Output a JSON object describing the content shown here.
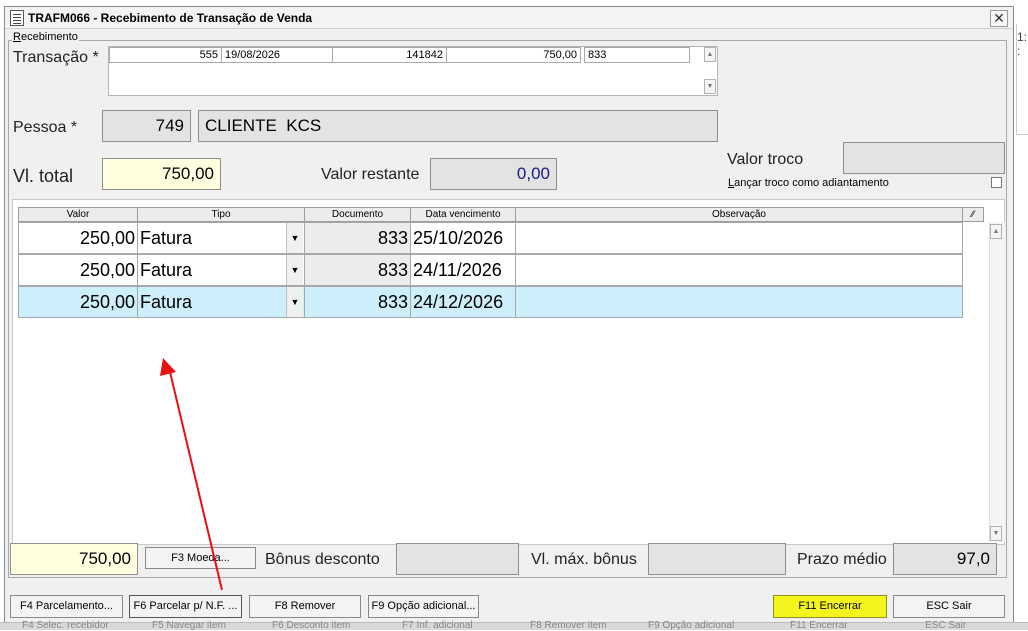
{
  "window": {
    "title": "TRAFM066 - Recebimento de Transação de Venda",
    "close_glyph": "✕"
  },
  "panel": {
    "label_underlined": "R",
    "label_rest": "ecebimento"
  },
  "transacao": {
    "label": "Transação *",
    "cells": [
      "555",
      "19/08/2026",
      "141842",
      "750,00",
      "833"
    ]
  },
  "pessoa": {
    "label": "Pessoa *",
    "code": "749",
    "name": "CLIENTE  KCS"
  },
  "totals": {
    "vl_total_label": "Vl. total",
    "vl_total": "750,00",
    "valor_restante_label": "Valor restante",
    "valor_restante": "0,00",
    "valor_troco_label": "Valor troco",
    "valor_troco": "",
    "lancar_troco_label_underlined": "L",
    "lancar_troco_label_rest": "ançar troco como adiantamento"
  },
  "grid": {
    "columns": [
      "Valor",
      "Tipo",
      "Documento",
      "Data vencimento",
      "Observação"
    ],
    "rows": [
      {
        "valor": "250,00",
        "tipo": "Fatura",
        "documento": "833",
        "data": "25/10/2026",
        "obs": ""
      },
      {
        "valor": "250,00",
        "tipo": "Fatura",
        "documento": "833",
        "data": "24/11/2026",
        "obs": ""
      },
      {
        "valor": "250,00",
        "tipo": "Fatura",
        "documento": "833",
        "data": "24/12/2026",
        "obs": ""
      }
    ]
  },
  "bottom": {
    "total": "750,00",
    "moeda_button": "F3 Moeda...",
    "bonus_label": "Bônus desconto",
    "bonus_value": "",
    "vl_max_label": "Vl. máx. bônus",
    "vl_max_value": "",
    "prazo_label": "Prazo médio",
    "prazo_value": "97,0"
  },
  "buttons": {
    "f4": "F4 Parcelamento...",
    "f6": "F6 Parcelar p/ N.F. ...",
    "f8": "F8 Remover",
    "f9": "F9 Opção adicional...",
    "f11": "F11 Encerrar",
    "esc": "ESC Sair"
  },
  "background_bar": [
    "F4 Selec. recebidor",
    "F5 Navegar item",
    "F6 Desconto item",
    "F7 Inf. adicional",
    "F8 Remover item",
    "F9 Opção adicional",
    "F11 Encerrar",
    "ESC Sair"
  ],
  "colors": {
    "highlight_field": "#ffffe0",
    "selected_row": "#cdeefb",
    "encerrar_button": "#f5f51e",
    "annotation_arrow": "#e81010"
  }
}
